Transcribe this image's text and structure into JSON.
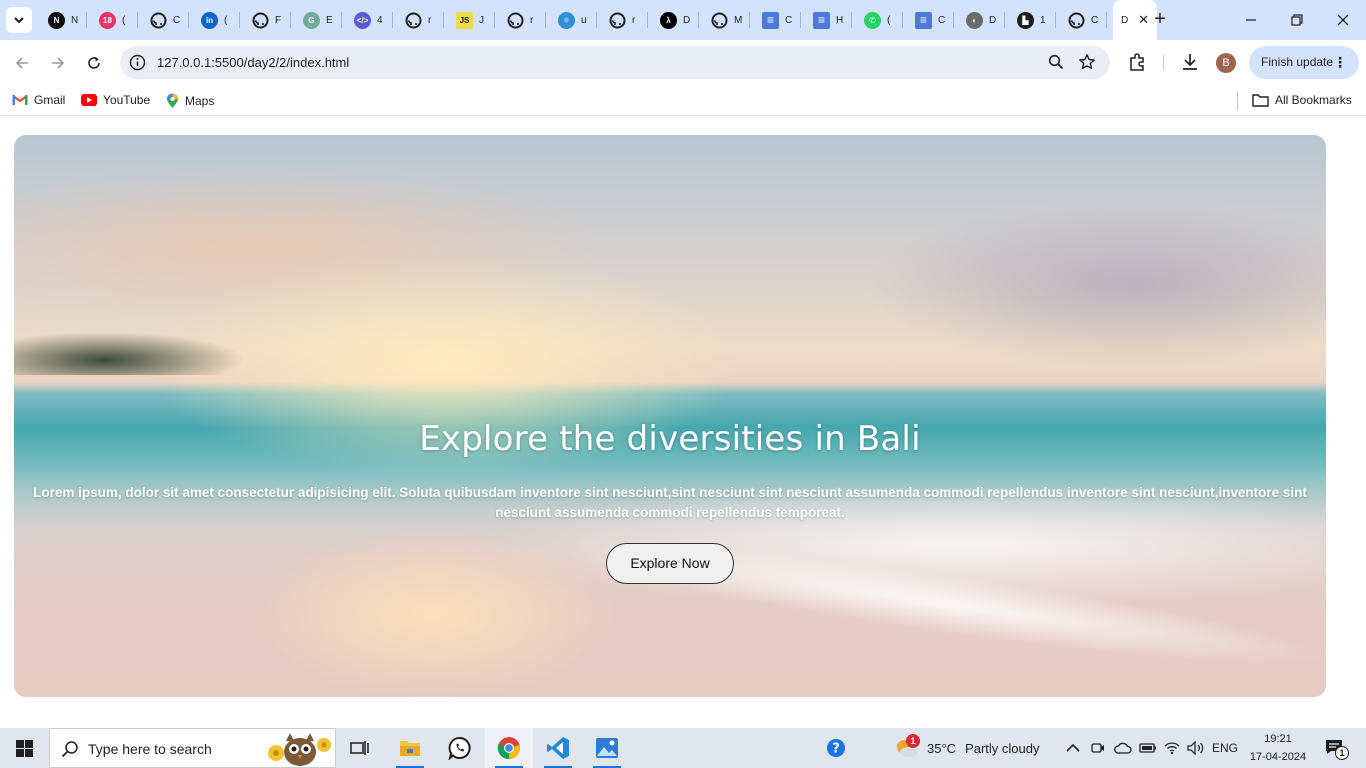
{
  "browser": {
    "tabs": [
      {
        "title": "N",
        "icon": "dev-community-icon",
        "color": "#0a0a0a",
        "glyph": "N"
      },
      {
        "title": "(",
        "icon": "youtube-notification-icon",
        "color": "#e8336b",
        "glyph": "18"
      },
      {
        "title": "C",
        "icon": "github-icon",
        "color": "#1f1f1f",
        "glyph": ""
      },
      {
        "title": "(",
        "icon": "linkedin-icon",
        "color": "#0a66c2",
        "glyph": "in"
      },
      {
        "title": "F",
        "icon": "github-icon",
        "color": "#1f1f1f",
        "glyph": ""
      },
      {
        "title": "E",
        "icon": "chatgpt-icon",
        "color": "#74aa9c",
        "glyph": "G"
      },
      {
        "title": "4",
        "icon": "code-icon",
        "color": "#5b5bd6",
        "glyph": "</>"
      },
      {
        "title": "r",
        "icon": "github-icon",
        "color": "#1f1f1f",
        "glyph": ""
      },
      {
        "title": "J",
        "icon": "javascript-icon",
        "color": "#f0db4f",
        "glyph": "JS"
      },
      {
        "title": "r",
        "icon": "github-icon",
        "color": "#1f1f1f",
        "glyph": ""
      },
      {
        "title": "u",
        "icon": "react-icon",
        "color": "#2f8fd8",
        "glyph": "⚛"
      },
      {
        "title": "r",
        "icon": "github-icon",
        "color": "#1f1f1f",
        "glyph": ""
      },
      {
        "title": "D",
        "icon": "vercel-icon",
        "color": "#000000",
        "glyph": "λ"
      },
      {
        "title": "M",
        "icon": "github-icon",
        "color": "#1f1f1f",
        "glyph": ""
      },
      {
        "title": "C",
        "icon": "docs-icon",
        "color": "#4a7bd8",
        "glyph": "≡"
      },
      {
        "title": "H",
        "icon": "docs-icon",
        "color": "#4a7bd8",
        "glyph": "≡"
      },
      {
        "title": "(",
        "icon": "whatsapp-icon",
        "color": "#25d366",
        "glyph": "✆"
      },
      {
        "title": "C",
        "icon": "docs-icon",
        "color": "#4a7bd8",
        "glyph": "≡"
      },
      {
        "title": "D",
        "icon": "globe-icon",
        "color": "#6b6b6b",
        "glyph": "◐"
      },
      {
        "title": "1",
        "icon": "unstop-icon",
        "color": "#1f1f1f",
        "glyph": "▙"
      },
      {
        "title": "C",
        "icon": "github-icon",
        "color": "#1f1f1f",
        "glyph": ""
      }
    ],
    "active_tab_title": "D",
    "url": "127.0.0.1:5500/day2/2/index.html",
    "profile_initial": "B",
    "finish_update_label": "Finish update",
    "bookmarks": [
      {
        "label": "Gmail",
        "icon": "gmail-icon"
      },
      {
        "label": "YouTube",
        "icon": "youtube-icon"
      },
      {
        "label": "Maps",
        "icon": "maps-icon"
      }
    ],
    "all_bookmarks_label": "All Bookmarks"
  },
  "hero": {
    "title": "Explore the diversities in Bali",
    "text": "Lorem ipsum, dolor sit amet consectetur adipisicing elit. Soluta quibusdam inventore sint nesciunt,sint nesciunt sint nesciunt assumenda commodi repellendus inventore sint nesciunt,inventore sint nesciunt assumenda commodi repellendus temporeat.",
    "button_label": "Explore Now"
  },
  "taskbar": {
    "search_placeholder": "Type here to search",
    "weather_temp": "35°C",
    "weather_desc": "Partly cloudy",
    "weather_badge": "1",
    "language": "ENG",
    "time": "19:21",
    "date": "17-04-2024",
    "notification_count": "1"
  }
}
